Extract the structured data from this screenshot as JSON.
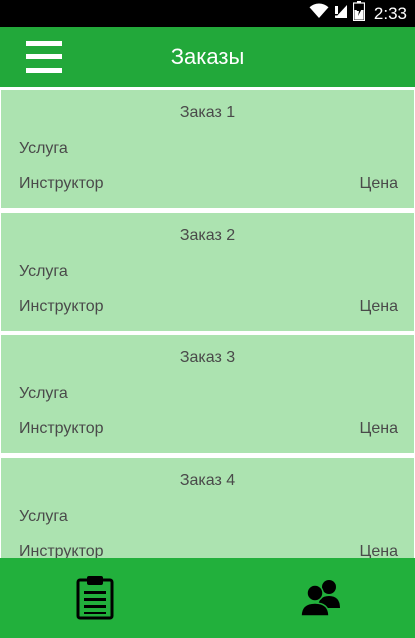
{
  "status_bar": {
    "time": "2:33",
    "icons": [
      "wifi-icon",
      "signal-icon",
      "battery-icon"
    ]
  },
  "app_bar": {
    "title": "Заказы",
    "menu_icon": "hamburger-menu-icon"
  },
  "orders": [
    {
      "title": "Заказ 1",
      "service": "Услуга",
      "instructor": "Инструктор",
      "price": "Цена"
    },
    {
      "title": "Заказ 2",
      "service": "Услуга",
      "instructor": "Инструктор",
      "price": "Цена"
    },
    {
      "title": "Заказ 3",
      "service": "Услуга",
      "instructor": "Инструктор",
      "price": "Цена"
    },
    {
      "title": "Заказ 4",
      "service": "Услуга",
      "instructor": "Инструктор",
      "price": "Цена"
    }
  ],
  "bottom_nav": {
    "items": [
      {
        "icon": "clipboard-list-icon"
      },
      {
        "icon": "users-icon"
      }
    ]
  },
  "colors": {
    "primary": "#22a83a",
    "bottom_nav": "#22b03c",
    "card_background": "#ace3b0",
    "text": "#4a4a4a",
    "status_bar": "#000000"
  }
}
